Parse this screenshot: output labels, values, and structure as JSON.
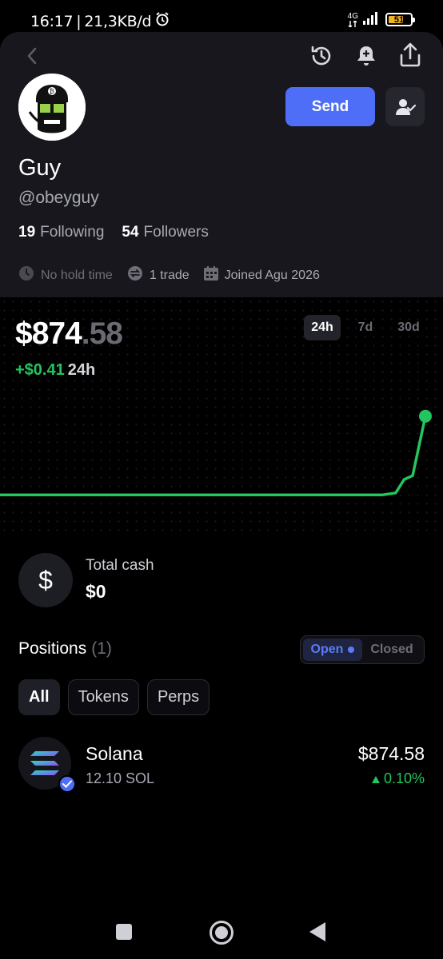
{
  "status_bar": {
    "time": "16:17",
    "separator": "|",
    "net_speed": "21,3KB/d",
    "network": "4G",
    "battery_level": "51",
    "battery_color": "#f0b429"
  },
  "header": {
    "back_icon": "chevron-left-icon",
    "history_icon": "history-icon",
    "notify_icon": "bell-plus-icon",
    "share_icon": "share-icon"
  },
  "profile": {
    "name": "Guy",
    "handle": "@obeyguy",
    "following_count": "19",
    "following_label": "Following",
    "followers_count": "54",
    "followers_label": "Followers",
    "send_label": "Send",
    "hold_time": "No hold time",
    "trades": "1 trade",
    "joined": "Joined Agu 2026"
  },
  "portfolio": {
    "balance_whole": "$874",
    "balance_cents": ".58",
    "change_value": "+$0.41",
    "change_period": "24h",
    "ranges": [
      "24h",
      "7d",
      "30d"
    ],
    "active_range": "24h"
  },
  "chart_data": {
    "type": "line",
    "title": "",
    "xlabel": "",
    "ylabel": "",
    "x": [
      0,
      10,
      20,
      30,
      40,
      50,
      60,
      70,
      80,
      90,
      93,
      95,
      97,
      100
    ],
    "values": [
      874.17,
      874.17,
      874.17,
      874.17,
      874.17,
      874.17,
      874.17,
      874.17,
      874.17,
      874.17,
      874.18,
      874.25,
      874.27,
      874.58
    ],
    "ylim": [
      874.15,
      874.6
    ],
    "grid": false,
    "color": "#22c55e"
  },
  "cash": {
    "icon": "dollar-icon",
    "label": "Total cash",
    "value": "$0"
  },
  "positions": {
    "title": "Positions",
    "count": "(1)",
    "open_label": "Open",
    "closed_label": "Closed",
    "filters": [
      "All",
      "Tokens",
      "Perps"
    ],
    "items": [
      {
        "name": "Solana",
        "amount": "12.10 SOL",
        "value": "$874.58",
        "change": "0.10%",
        "change_color": "#22c55e"
      }
    ]
  },
  "colors": {
    "accent": "#4f6ef7",
    "positive": "#22c55e",
    "card": "#17171d"
  }
}
